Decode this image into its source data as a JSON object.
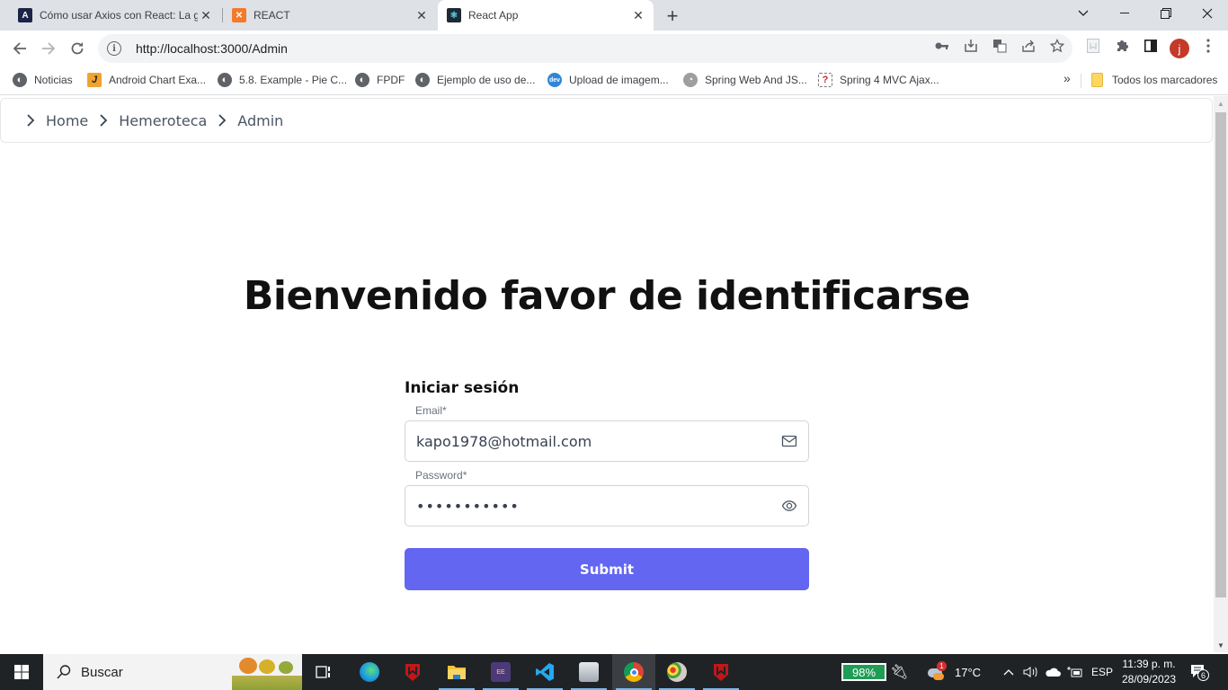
{
  "browser": {
    "tabs": [
      {
        "title": "Cómo usar Axios con React: La g",
        "favicon": "axios-site-icon",
        "favicon_color": "#1b2447",
        "active": false
      },
      {
        "title": "REACT",
        "favicon": "xampp-icon",
        "favicon_color": "#f37b2a",
        "active": false
      },
      {
        "title": "React App",
        "favicon": "react-icon",
        "favicon_color": "#1d2b35",
        "active": true
      }
    ],
    "new_tab_label": "+",
    "url": "http://localhost:3000/Admin",
    "profile_initial": "j",
    "bookmarks": [
      {
        "label": "Noticias",
        "icon": "globe-icon"
      },
      {
        "label": "Android Chart Exa...",
        "icon": "j-icon"
      },
      {
        "label": "5.8. Example - Pie C...",
        "icon": "globe-icon"
      },
      {
        "label": "FPDF",
        "icon": "globe-icon"
      },
      {
        "label": "Ejemplo de uso de...",
        "icon": "globe-icon"
      },
      {
        "label": "Upload de imagem...",
        "icon": "devmedia-icon"
      },
      {
        "label": "Spring Web And JS...",
        "icon": "clock-site-icon"
      },
      {
        "label": "Spring 4 MVC Ajax...",
        "icon": "question-site-icon"
      }
    ],
    "bookmarks_overflow": "»",
    "all_bookmarks_label": "Todos los marcadores"
  },
  "page": {
    "breadcrumb": [
      "Home",
      "Hemeroteca",
      "Admin"
    ],
    "heading": "Bienvenido favor de identificarse",
    "form": {
      "title": "Iniciar sesión",
      "email_label": "Email*",
      "email_value": "kapo1978@hotmail.com",
      "password_label": "Password*",
      "password_value": "•••••••••••",
      "submit_label": "Submit"
    },
    "accent_color": "#6366f1"
  },
  "taskbar": {
    "search_label": "Buscar",
    "battery": "98%",
    "temperature": "17°C",
    "weather_badge": "1",
    "language": "ESP",
    "time": "11:39 p. m.",
    "date": "28/09/2023",
    "notifications": "6"
  }
}
